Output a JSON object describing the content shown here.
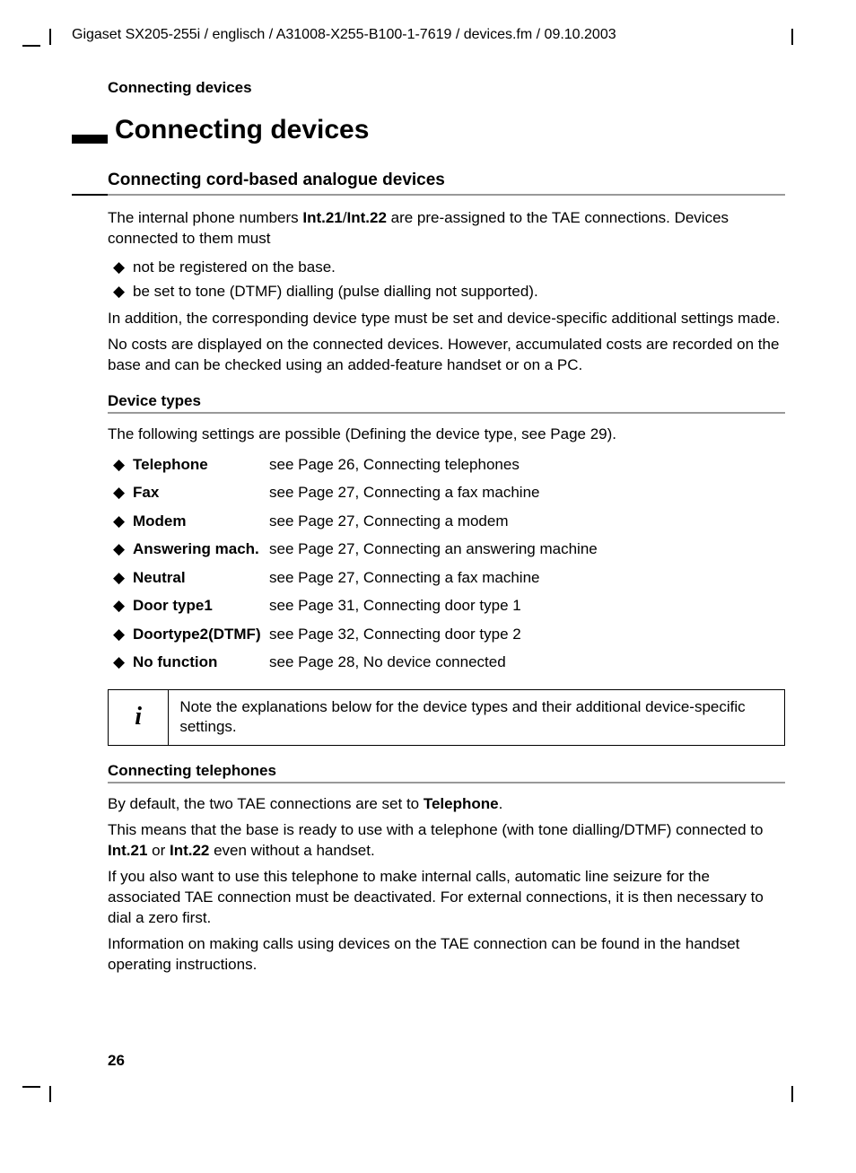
{
  "header_path": "Gigaset SX205-255i / englisch / A31008-X255-B100-1-7619 / devices.fm / 09.10.2003",
  "running_head": "Connecting devices",
  "chapter_title": "Connecting devices",
  "section1": {
    "title": "Connecting cord-based analogue devices",
    "intro_pre": "The internal phone numbers ",
    "int21": "Int.21",
    "slash": "/",
    "int22": "Int.22",
    "intro_post": " are pre-assigned to the TAE connections. Devices connected to them must",
    "bullets": [
      "not be registered on the base.",
      "be set to tone (DTMF) dialling (pulse dialling not supported)."
    ],
    "p2": "In addition, the corresponding device type must be set and device-specific additional settings made.",
    "p3": "No costs are displayed on the connected devices. However, accumulated costs are recorded on the base and can be checked using an added-feature handset or on a PC."
  },
  "device_types": {
    "heading": "Device types",
    "intro": "The following settings are possible (Defining the device type, see Page 29).",
    "rows": [
      {
        "label": "Telephone",
        "desc": "see Page 26, Connecting telephones"
      },
      {
        "label": "Fax",
        "desc": "see Page 27, Connecting a fax machine"
      },
      {
        "label": "Modem",
        "desc": "see Page 27, Connecting a modem"
      },
      {
        "label": "Answering mach.",
        "desc": "see Page 27, Connecting an answering machine"
      },
      {
        "label": "Neutral",
        "desc": "see Page 27, Connecting a fax machine"
      },
      {
        "label": "Door type1",
        "desc": "see Page 31, Connecting door type 1"
      },
      {
        "label": "Doortype2(DTMF)",
        "desc": "see Page 32, Connecting door type 2"
      },
      {
        "label": "No function",
        "desc": "see Page 28, No device connected"
      }
    ],
    "note": "Note the explanations below for the device types and their additional device-specific settings."
  },
  "connecting_telephones": {
    "heading": "Connecting telephones",
    "p1_pre": "By default, the two TAE connections are set to ",
    "p1_bold": "Telephone",
    "p1_post": ".",
    "p2_pre": "This means that the base is ready to use with a telephone (with tone dialling/DTMF) connected to ",
    "p2_b1": "Int.21",
    "p2_mid": " or ",
    "p2_b2": "Int.22",
    "p2_post": " even without a handset.",
    "p3": "If you also want to use this telephone to make internal calls, automatic line seizure for the associated TAE connection must be deactivated. For external connections, it is then necessary to dial a zero first.",
    "p4": "Information on making calls using devices on the TAE connection can be found in the handset operating instructions."
  },
  "page_number": "26",
  "diamond": "◆",
  "info_glyph": "i"
}
